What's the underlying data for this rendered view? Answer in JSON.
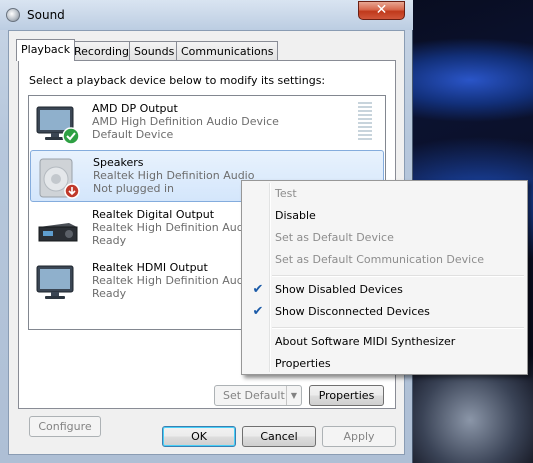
{
  "window": {
    "title": "Sound",
    "close_label": "✕"
  },
  "tabs": [
    {
      "label": "Playback",
      "active": true
    },
    {
      "label": "Recording",
      "active": false
    },
    {
      "label": "Sounds",
      "active": false
    },
    {
      "label": "Communications",
      "active": false
    }
  ],
  "instruction": "Select a playback device below to modify its settings:",
  "devices": [
    {
      "name": "AMD  DP  Output",
      "line2": "AMD High Definition Audio Device",
      "line3": "Default Device",
      "icon": "monitor-icon",
      "badge": "default-check-icon"
    },
    {
      "name": "Speakers",
      "line2": "Realtek High Definition Audio",
      "line3": "Not plugged in",
      "icon": "speaker-icon",
      "badge": "unplugged-arrow-icon",
      "selected": true
    },
    {
      "name": "Realtek Digital Output",
      "line2": "Realtek High Definition Audio",
      "line3": "Ready",
      "icon": "receiver-icon"
    },
    {
      "name": "Realtek HDMI Output",
      "line2": "Realtek High Definition Audio",
      "line3": "Ready",
      "icon": "monitor-icon"
    }
  ],
  "buttons": {
    "configure": "Configure",
    "set_default": "Set Default",
    "properties": "Properties",
    "ok": "OK",
    "cancel": "Cancel",
    "apply": "Apply"
  },
  "context_menu": {
    "items": [
      {
        "label": "Test",
        "enabled": false
      },
      {
        "label": "Disable",
        "enabled": true
      },
      {
        "label": "Set as Default Device",
        "enabled": false
      },
      {
        "label": "Set as Default Communication Device",
        "enabled": false
      },
      {
        "label": "Show Disabled Devices",
        "enabled": true,
        "checked": true
      },
      {
        "label": "Show Disconnected Devices",
        "enabled": true,
        "checked": true
      },
      {
        "label": "About Software MIDI Synthesizer",
        "enabled": true
      },
      {
        "label": "Properties",
        "enabled": true
      }
    ],
    "check_glyph": "✔"
  },
  "colors": {
    "selection": "#d4e6fb",
    "check_green": "#2ea043",
    "unplugged_red": "#c0392b"
  }
}
